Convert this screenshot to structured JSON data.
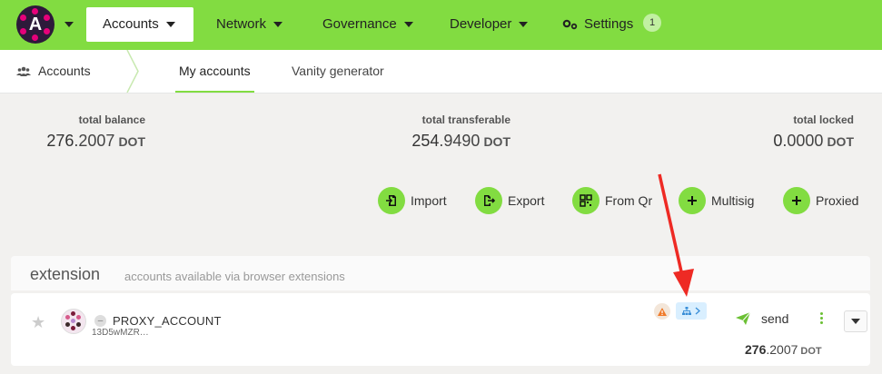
{
  "nav": {
    "tabs": [
      {
        "label": "Accounts",
        "active": true
      },
      {
        "label": "Network"
      },
      {
        "label": "Governance"
      },
      {
        "label": "Developer"
      },
      {
        "label": "Settings"
      }
    ],
    "settings_badge": "1",
    "logo_letter": "A",
    "logo_color": "#e6007a",
    "brand_color": "#82dc41"
  },
  "subnav": {
    "section": "Accounts",
    "tabs": [
      "My accounts",
      "Vanity generator"
    ]
  },
  "summary": {
    "total_balance": {
      "label": "total balance",
      "int": "276",
      "dec": ".2007",
      "unit": "DOT"
    },
    "total_transferable": {
      "label": "total transferable",
      "int": "254",
      "dec": ".9490",
      "unit": "DOT"
    },
    "total_locked": {
      "label": "total locked",
      "int": "0",
      "dec": ".0000",
      "unit": "DOT"
    }
  },
  "actions": [
    "Import",
    "Export",
    "From Qr",
    "Multisig",
    "Proxied"
  ],
  "extension": {
    "title": "extension",
    "subtitle": "accounts available via browser extensions",
    "account": {
      "name": "PROXY_ACCOUNT",
      "address": "13D5wMZR…",
      "send_label": "send",
      "balance_int": "276",
      "balance_dec": ".2007",
      "balance_unit": "DOT"
    }
  }
}
